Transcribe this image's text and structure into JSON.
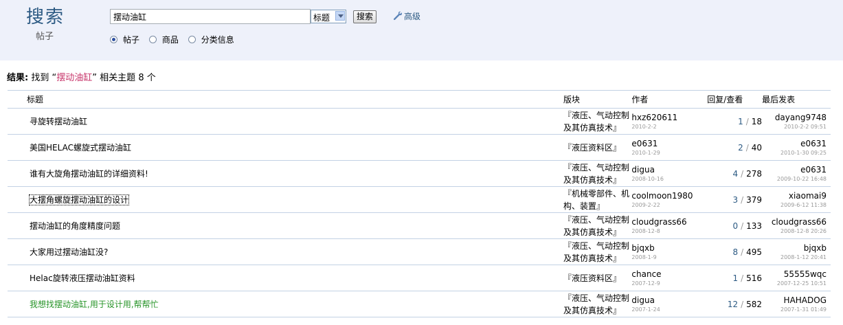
{
  "header": {
    "title": "搜索",
    "subtitle": "帖子",
    "search_value": "摆动油缸",
    "scope_select": "标题",
    "search_button": "搜索",
    "advanced_link": "高级",
    "radios": [
      "帖子",
      "商品",
      "分类信息"
    ],
    "radio_selected": "帖子"
  },
  "result": {
    "label": "结果:",
    "found": "找到",
    "open_quote": "“",
    "keyword": "摆动油缸",
    "close_quote": "”",
    "suffix": "相关主题",
    "count": "8 个"
  },
  "columns": {
    "title": "标题",
    "forum": "版块",
    "author": "作者",
    "stats": "回复/查看",
    "last": "最后发表"
  },
  "threads": [
    {
      "title": "寻旋转摆动油缸",
      "forum": "『液压、气动控制及其仿真技术』",
      "author": "hxz620611",
      "date": "2010-2-2",
      "replies": "1",
      "views": "18",
      "last_user": "dayang9748",
      "last_date": "2010-2-2 09:51"
    },
    {
      "title": "美国HELAC螺旋式摆动油缸",
      "forum": "『液压资料区』",
      "author": "e0631",
      "date": "2010-1-29",
      "replies": "2",
      "views": "40",
      "last_user": "e0631",
      "last_date": "2010-1-30 09:25"
    },
    {
      "title": "谁有大旋角摆动油缸的详细资料!",
      "forum": "『液压、气动控制及其仿真技术』",
      "author": "digua",
      "date": "2008-10-16",
      "replies": "4",
      "views": "278",
      "last_user": "e0631",
      "last_date": "2009-10-22 16:48"
    },
    {
      "title": "大摆角螺旋摆动油缸的设计",
      "forum": "『机械零部件、机构、装置』",
      "author": "coolmoon1980",
      "date": "2009-2-22",
      "replies": "3",
      "views": "379",
      "last_user": "xiaomai9",
      "last_date": "2009-6-12 11:38"
    },
    {
      "title": "摆动油缸的角度精度问题",
      "forum": "『液压、气动控制及其仿真技术』",
      "author": "cloudgrass66",
      "date": "2008-12-8",
      "replies": "0",
      "views": "133",
      "last_user": "cloudgrass66",
      "last_date": "2008-12-8 20:26"
    },
    {
      "title": "大家用过摆动油缸没?",
      "forum": "『液压、气动控制及其仿真技术』",
      "author": "bjqxb",
      "date": "2008-1-9",
      "replies": "8",
      "views": "495",
      "last_user": "bjqxb",
      "last_date": "2008-1-12 20:41"
    },
    {
      "title": "Helac旋转液压摆动油缸资料",
      "forum": "『液压资料区』",
      "author": "chance",
      "date": "2007-12-9",
      "replies": "1",
      "views": "516",
      "last_user": "55555wqc",
      "last_date": "2007-12-25 10:51"
    },
    {
      "title": "我想找摆动油缸,用于设计用,帮帮忙",
      "forum": "『液压、气动控制及其仿真技术』",
      "author": "digua",
      "date": "2007-1-24",
      "replies": "12",
      "views": "582",
      "last_user": "HAHADOG",
      "last_date": "2007-1-31 01:49"
    }
  ],
  "colors": {
    "header_bg": "#eef1fa",
    "link": "#2c5a83",
    "keyword": "#c7346a",
    "green": "#279428"
  },
  "icons": {
    "advanced": "wrench-icon"
  }
}
